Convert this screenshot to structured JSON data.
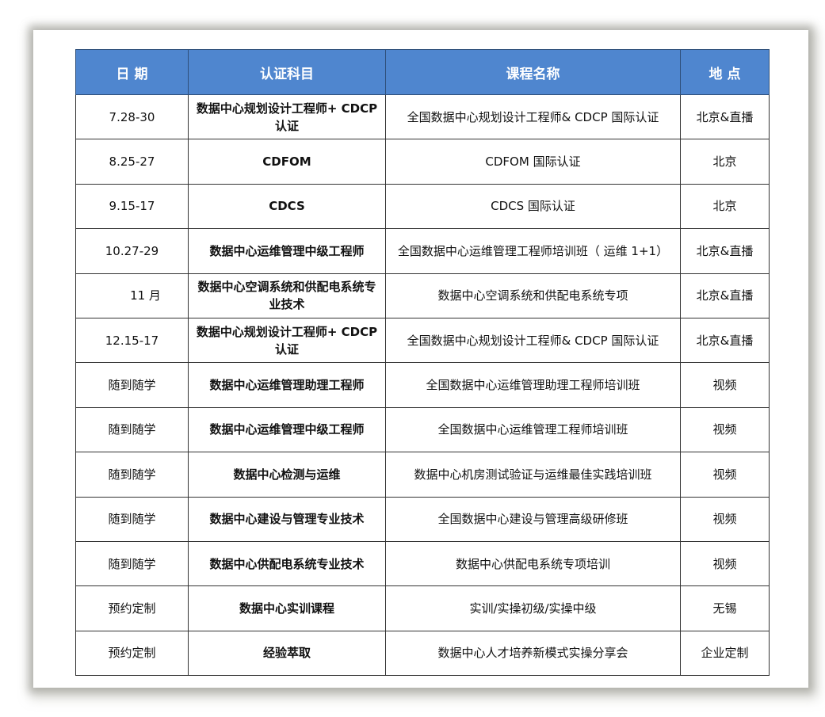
{
  "table": {
    "headers": {
      "date": "日 期",
      "subject": "认证科目",
      "course": "课程名称",
      "location": "地 点"
    },
    "rows": [
      {
        "date": "7.28-30",
        "subject": "数据中心规划设计工程师+ CDCP 认证",
        "course": "全国数据中心规划设计工程师& CDCP 国际认证",
        "location": "北京&直播"
      },
      {
        "date": "8.25-27",
        "subject": "CDFOM",
        "course": "CDFOM 国际认证",
        "location": "北京"
      },
      {
        "date": "9.15-17",
        "subject": "CDCS",
        "course": "CDCS 国际认证",
        "location": "北京"
      },
      {
        "date": "10.27-29",
        "subject": "数据中心运维管理中级工程师",
        "course": "全国数据中心运维管理工程师培训班（ 运维 1+1）",
        "location": "北京&直播"
      },
      {
        "date": "11 月",
        "subject": "数据中心空调系统和供配电系统专业技术",
        "course": "数据中心空调系统和供配电系统专项",
        "location": "北京&直播"
      },
      {
        "date": "12.15-17",
        "subject": "数据中心规划设计工程师+ CDCP 认证",
        "course": "全国数据中心规划设计工程师& CDCP 国际认证",
        "location": "北京&直播"
      },
      {
        "date": "随到随学",
        "subject": "数据中心运维管理助理工程师",
        "course": "全国数据中心运维管理助理工程师培训班",
        "location": "视频"
      },
      {
        "date": "随到随学",
        "subject": "数据中心运维管理中级工程师",
        "course": "全国数据中心运维管理工程师培训班",
        "location": "视频"
      },
      {
        "date": "随到随学",
        "subject": "数据中心检测与运维",
        "course": "数据中心机房测试验证与运维最佳实践培训班",
        "location": "视频"
      },
      {
        "date": "随到随学",
        "subject": "数据中心建设与管理专业技术",
        "course": "全国数据中心建设与管理高级研修班",
        "location": "视频"
      },
      {
        "date": "随到随学",
        "subject": "数据中心供配电系统专业技术",
        "course": "数据中心供配电系统专项培训",
        "location": "视频"
      },
      {
        "date": "预约定制",
        "subject": "数据中心实训课程",
        "course": "实训/实操初级/实操中级",
        "location": "无锡"
      },
      {
        "date": "预约定制",
        "subject": "经验萃取",
        "course": "数据中心人才培养新模式实操分享会",
        "location": "企业定制"
      }
    ]
  },
  "colors": {
    "header_bg": "#4f86cf",
    "header_text": "#ffffff",
    "border": "#333333"
  }
}
